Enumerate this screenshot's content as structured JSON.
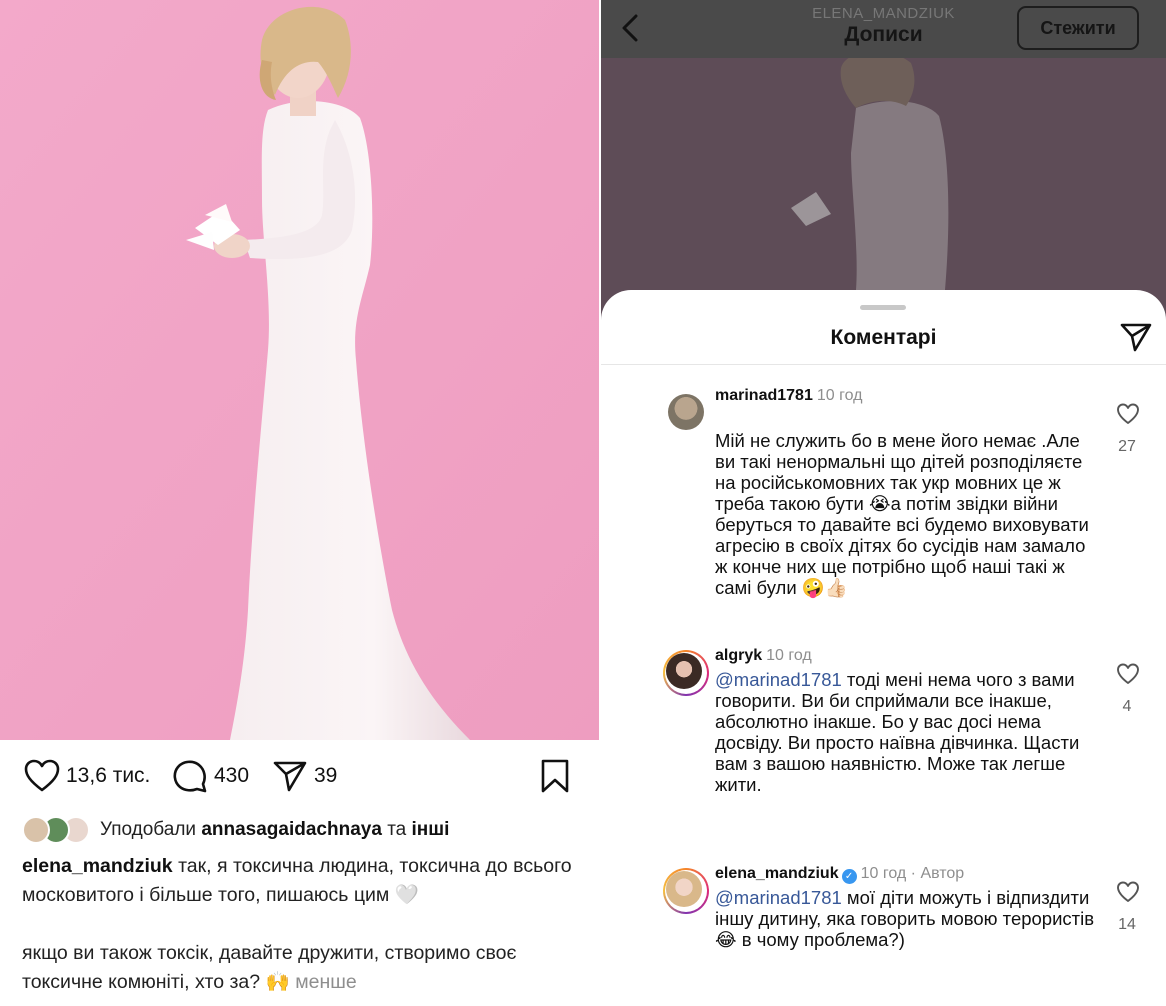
{
  "post": {
    "likes": "13,6 тис.",
    "comments_count": "430",
    "shares_count": "39",
    "liked_by_prefix": "Уподобали",
    "liked_by_user": "annasagaidachnaya",
    "liked_by_and": "та",
    "liked_by_others": "інші",
    "caption_user": "elena_mandziuk",
    "caption_p1": "так, я токсична людина, токсична до всього московитого і більше того, пишаюсь цим 🤍",
    "caption_p2": "якщо ви також токсік, давайте дружити, створимо своє токсичне комюніті, хто за? 🙌",
    "caption_less": "менше",
    "icons": [
      "heart-icon",
      "comment-icon",
      "share-icon",
      "bookmark-icon"
    ]
  },
  "right": {
    "header_user": "ELENA_MANDZIUK",
    "header_title": "Дописи",
    "follow_label": "Стежити",
    "sheet_title": "Коментарі"
  },
  "comments": [
    {
      "user": "marinad1781",
      "time": "10 год",
      "text": "Мій не служить бо в мене його немає .Але ви такі ненормальні що дітей розподіляєте на російськомовних так укр мовних це ж треба такою бути 😭а потім звідки війни беруться то давайте всі будемо виховувати агресію в своїх дітях бо сусідів нам замало ж конче них ще потрібно щоб наші такі ж самі були 🤪👍🏻",
      "likes": "27"
    },
    {
      "user": "algryk",
      "time": "10 год",
      "mention": "@marinad1781",
      "text": " тоді мені нема чого з вами говорити. Ви би сприймали все інакше, абсолютно інакше. Бо у вас досі нема досвіду. Ви просто наївна дівчинка. Щасти вам з вашою наявністю. Може так легше жити.",
      "likes": "4"
    },
    {
      "user": "elena_mandziuk",
      "time": "10 год · Автор",
      "mention": "@marinad1781",
      "text": " мої діти можуть і відпиздити іншу дитину, яка говорить мовою терористів 😂 в чому проблема?)",
      "likes": "14"
    }
  ],
  "colors": {
    "photo_background": "#f1a6c8",
    "dimmed_overlay": "#5e4c57",
    "mention": "#385898",
    "muted": "#8e8e8e"
  }
}
